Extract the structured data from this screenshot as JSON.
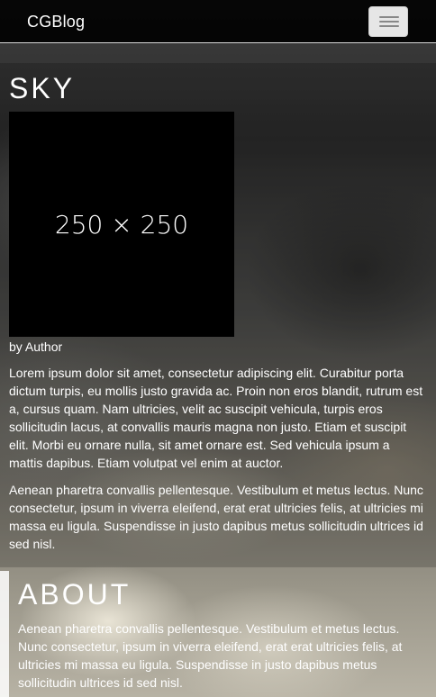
{
  "navbar": {
    "brand": "CGBlog",
    "toggle_icon": "hamburger-menu-icon"
  },
  "post": {
    "title": "SKY",
    "image_placeholder": "250 × 250",
    "byline": "by Author",
    "paragraphs": [
      "Lorem ipsum dolor sit amet, consectetur adipiscing elit. Curabitur porta dictum turpis, eu mollis justo gravida ac. Proin non eros blandit, rutrum est a, cursus quam. Nam ultricies, velit ac suscipit vehicula, turpis eros sollicitudin lacus, at convallis mauris magna non justo. Etiam et suscipit elit. Morbi eu ornare nulla, sit amet ornare est. Sed vehicula ipsum a mattis dapibus. Etiam volutpat vel enim at auctor.",
      "Aenean pharetra convallis pellentesque. Vestibulum et metus lectus. Nunc consectetur, ipsum in viverra eleifend, erat erat ultricies felis, at ultricies mi massa eu ligula. Suspendisse in justo dapibus metus sollicitudin ultrices id sed nisl."
    ]
  },
  "about": {
    "title": "ABOUT",
    "text": "Aenean pharetra convallis pellentesque. Vestibulum et metus lectus. Nunc consectetur, ipsum in viverra eleifend, erat erat ultricies felis, at ultricies mi massa eu ligula. Suspendisse in justo dapibus metus sollicitudin ultrices id sed nisl."
  },
  "colors": {
    "navbar_bg": "#000000",
    "text": "#ffffff",
    "toggle_bg": "#e6e6e6",
    "placeholder_bg": "#000000"
  }
}
